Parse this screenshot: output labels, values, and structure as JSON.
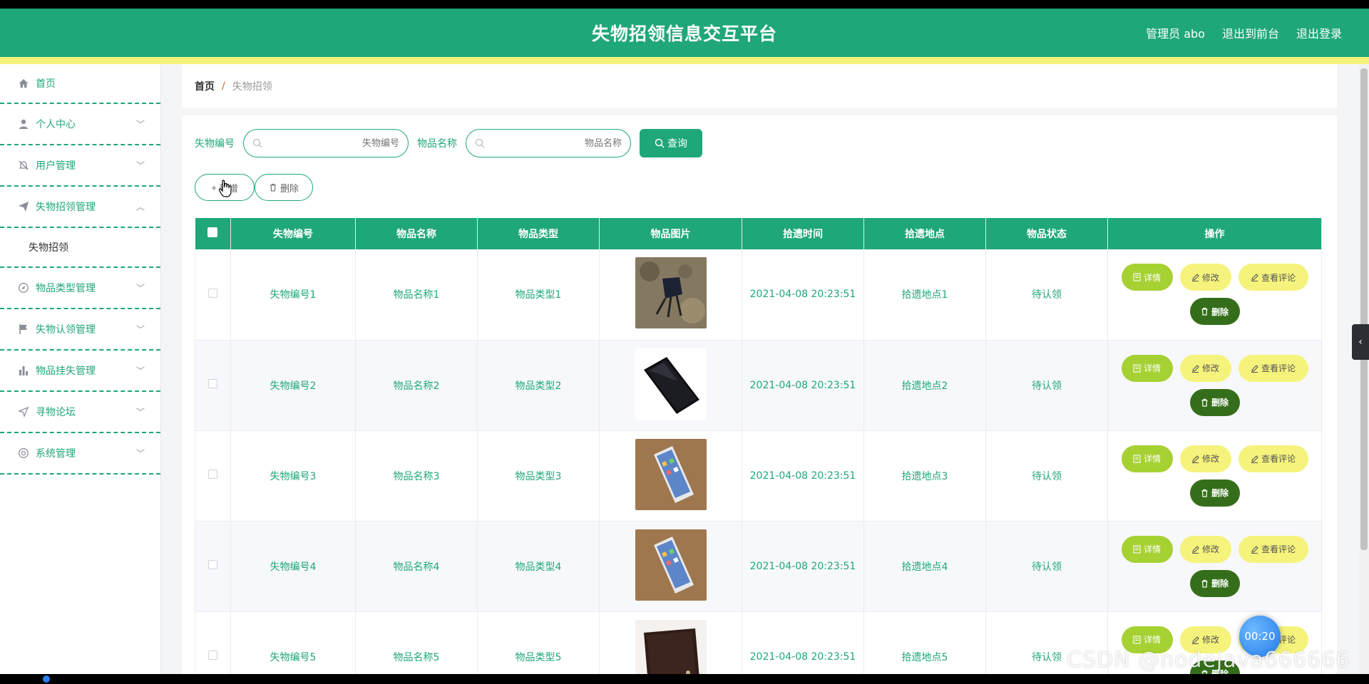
{
  "header": {
    "title": "失物招领信息交互平台",
    "admin_label": "管理员 abo",
    "to_front_label": "退出到前台",
    "logout_label": "退出登录"
  },
  "sidebar": {
    "items": [
      {
        "label": "首页",
        "icon": "home-icon"
      },
      {
        "label": "个人中心",
        "icon": "user-icon"
      },
      {
        "label": "用户管理",
        "icon": "bell-off-icon"
      },
      {
        "label": "失物招领管理",
        "icon": "send-icon"
      },
      {
        "label": "物品类型管理",
        "icon": "compass-icon"
      },
      {
        "label": "失物认领管理",
        "icon": "flag-icon"
      },
      {
        "label": "物品挂失管理",
        "icon": "bar-chart-icon"
      },
      {
        "label": "寻物论坛",
        "icon": "navigation-icon"
      },
      {
        "label": "系统管理",
        "icon": "settings-icon"
      }
    ],
    "sub_item": "失物招领"
  },
  "breadcrumb": {
    "home": "首页",
    "separator": "/",
    "current": "失物招领"
  },
  "search": {
    "field1_label": "失物编号",
    "field1_placeholder": "失物编号",
    "field2_label": "物品名称",
    "field2_placeholder": "物品名称",
    "query_label": "查询"
  },
  "actions": {
    "add_label": "新增",
    "delete_label": "删除"
  },
  "table": {
    "headers": [
      "失物编号",
      "物品名称",
      "物品类型",
      "物品图片",
      "拾遗时间",
      "拾遗地点",
      "物品状态",
      "操作"
    ],
    "rows": [
      {
        "code": "失物编号1",
        "name": "物品名称1",
        "type": "物品类型1",
        "image": "black-object-photo",
        "time": "2021-04-08 20:23:51",
        "place": "拾遗地点1",
        "status": "待认领"
      },
      {
        "code": "失物编号2",
        "name": "物品名称2",
        "type": "物品类型2",
        "image": "black-phone-photo",
        "time": "2021-04-08 20:23:51",
        "place": "拾遗地点2",
        "status": "待认领"
      },
      {
        "code": "失物编号3",
        "name": "物品名称3",
        "type": "物品类型3",
        "image": "iphone-on-wood-photo",
        "time": "2021-04-08 20:23:51",
        "place": "拾遗地点3",
        "status": "待认领"
      },
      {
        "code": "失物编号4",
        "name": "物品名称4",
        "type": "物品类型4",
        "image": "iphone-on-wood-photo",
        "time": "2021-04-08 20:23:51",
        "place": "拾遗地点4",
        "status": "待认领"
      },
      {
        "code": "失物编号5",
        "name": "物品名称5",
        "type": "物品类型5",
        "image": "wallet-photo",
        "time": "2021-04-08 20:23:51",
        "place": "拾遗地点5",
        "status": "待认领"
      }
    ],
    "op_detail": "详情",
    "op_edit": "修改",
    "op_view_comments": "查看评论",
    "op_delete": "删除"
  },
  "overlay": {
    "timer": "00:20",
    "watermark": "CSDN @nodejava666666"
  },
  "colors": {
    "primary": "#1fa77a",
    "accent_yellow": "#f5f37b",
    "detail_green": "#a6d133",
    "delete_dark": "#356e1a"
  }
}
